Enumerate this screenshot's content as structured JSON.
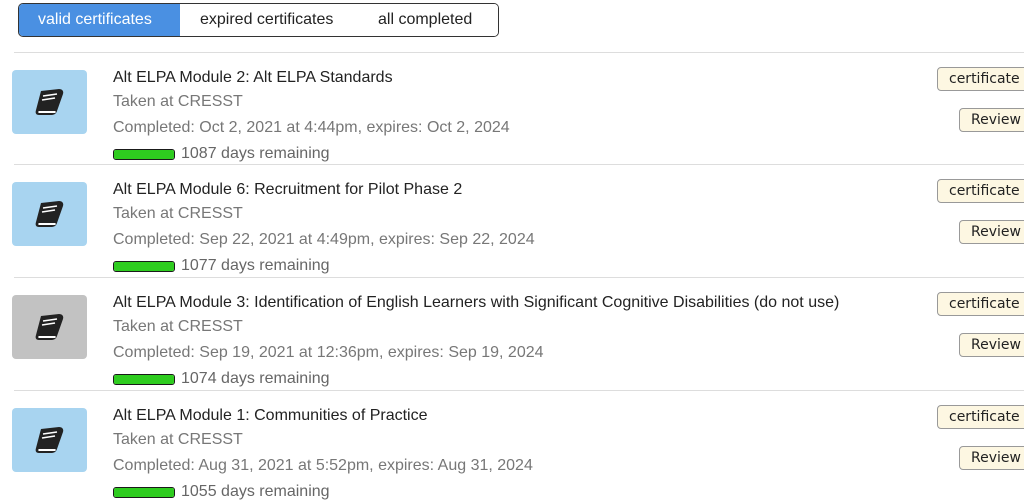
{
  "tabs": [
    {
      "label": "valid certificates",
      "active": true
    },
    {
      "label": "expired certificates",
      "active": false
    },
    {
      "label": "all completed",
      "active": false
    }
  ],
  "colors": {
    "active_tab": "#4a90e2",
    "thumb_active": "#a8d4f0",
    "thumb_inactive": "#c2c2c2",
    "progress": "#2ecc1f",
    "button_bg": "#fdf7e2"
  },
  "certificates": [
    {
      "title": "Alt ELPA Module 2: Alt ELPA Standards",
      "taken": "Taken at CRESST",
      "completed": "Completed: Oct 2, 2021 at 4:44pm, expires: Oct 2, 2024",
      "remaining": "1087 days remaining",
      "remaining_fraction": 1.0,
      "icon": "book-icon",
      "thumb_style": "active",
      "certificate_label": "certificate",
      "review_label": "Review"
    },
    {
      "title": "Alt ELPA Module 6: Recruitment for Pilot Phase 2",
      "taken": "Taken at CRESST",
      "completed": "Completed: Sep 22, 2021 at 4:49pm, expires: Sep 22, 2024",
      "remaining": "1077 days remaining",
      "remaining_fraction": 1.0,
      "icon": "book-icon",
      "thumb_style": "active",
      "certificate_label": "certificate",
      "review_label": "Review"
    },
    {
      "title": "Alt ELPA Module 3: Identification of English Learners with Significant Cognitive Disabilities (do not use)",
      "taken": "Taken at CRESST",
      "completed": "Completed: Sep 19, 2021 at 12:36pm, expires: Sep 19, 2024",
      "remaining": "1074 days remaining",
      "remaining_fraction": 1.0,
      "icon": "book-icon",
      "thumb_style": "inactive",
      "certificate_label": "certificate",
      "review_label": "Review"
    },
    {
      "title": "Alt ELPA Module 1: Communities of Practice",
      "taken": "Taken at CRESST",
      "completed": "Completed: Aug 31, 2021 at 5:52pm, expires: Aug 31, 2024",
      "remaining": "1055 days remaining",
      "remaining_fraction": 1.0,
      "icon": "book-icon",
      "thumb_style": "active",
      "certificate_label": "certificate",
      "review_label": "Review"
    }
  ]
}
